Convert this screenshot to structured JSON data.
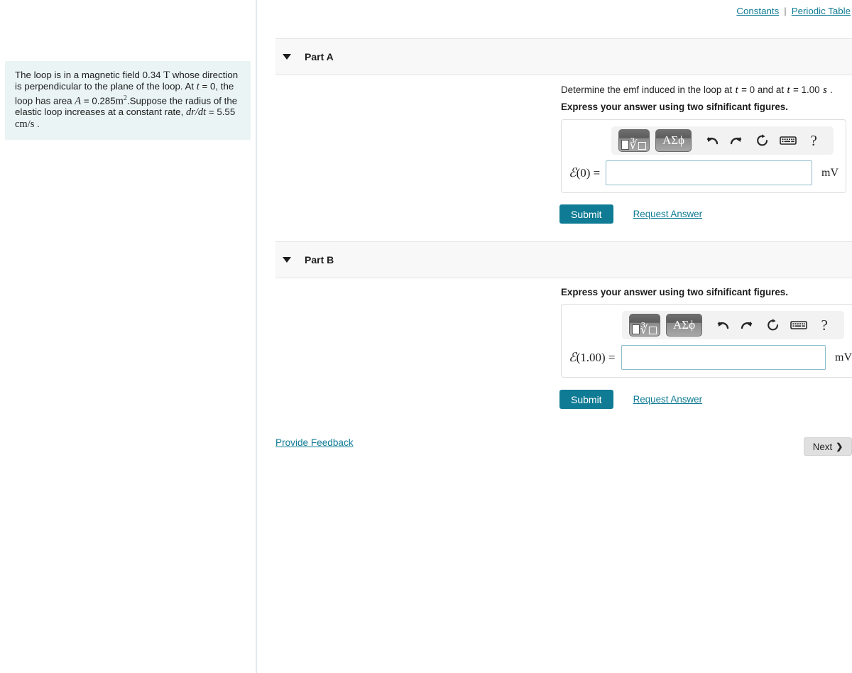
{
  "toplinks": {
    "constants": "Constants",
    "separator": "|",
    "periodic_table": "Periodic Table"
  },
  "problem": {
    "line1_a": "The loop is in a magnetic field 0.34",
    "field_unit": "T",
    "line1_b": "whose direction is perpendicular to the plane of the loop. At",
    "t_var": "t",
    "line1_c": "= 0, the loop has area",
    "area_var": "A",
    "line1_d": "= 0.285",
    "area_unit": "m",
    "area_exp": "2",
    "line1_e": ".Suppose the radius of the elastic loop increases at a constant rate,",
    "rate_var": "dr/dt",
    "line1_f": "= 5.55",
    "rate_unit": "cm/s",
    "line1_g": "."
  },
  "partA": {
    "title": "Part A",
    "prompt_a": "Determine the emf induced in the loop at",
    "prompt_t1": "t",
    "prompt_b": "= 0 and at",
    "prompt_t2": "t",
    "prompt_c": "= 1.00",
    "prompt_s": "s",
    "prompt_d": ".",
    "instruction": "Express your answer using two sifnificant figures.",
    "label_E": "ℰ",
    "label_arg": "(0) =",
    "input_value": "",
    "input_placeholder": "",
    "unit": "mV",
    "submit_label": "Submit",
    "request_label": "Request Answer",
    "toolbar": {
      "template_label": "√",
      "greek_label": "ΑΣϕ",
      "undo": "undo-arrow",
      "redo": "redo-arrow",
      "reset": "reset-arrow",
      "keyboard": "keyboard",
      "help": "?"
    }
  },
  "partB": {
    "title": "Part B",
    "instruction": "Express your answer using two sifnificant figures.",
    "label_E": "ℰ",
    "label_arg": "(1.00) =",
    "input_value": "",
    "input_placeholder": "",
    "unit": "mV",
    "submit_label": "Submit",
    "request_label": "Request Answer",
    "toolbar": {
      "template_label": "√",
      "greek_label": "ΑΣϕ",
      "undo": "undo-arrow",
      "redo": "redo-arrow",
      "reset": "reset-arrow",
      "keyboard": "keyboard",
      "help": "?"
    }
  },
  "footer": {
    "feedback": "Provide Feedback",
    "next": "Next",
    "next_chevron": "❯"
  },
  "colors": {
    "accent_teal": "#0f7b94",
    "panel_bg": "#f8f8f8",
    "problem_bg": "#eaf4f4",
    "input_border": "#8ebccb"
  }
}
